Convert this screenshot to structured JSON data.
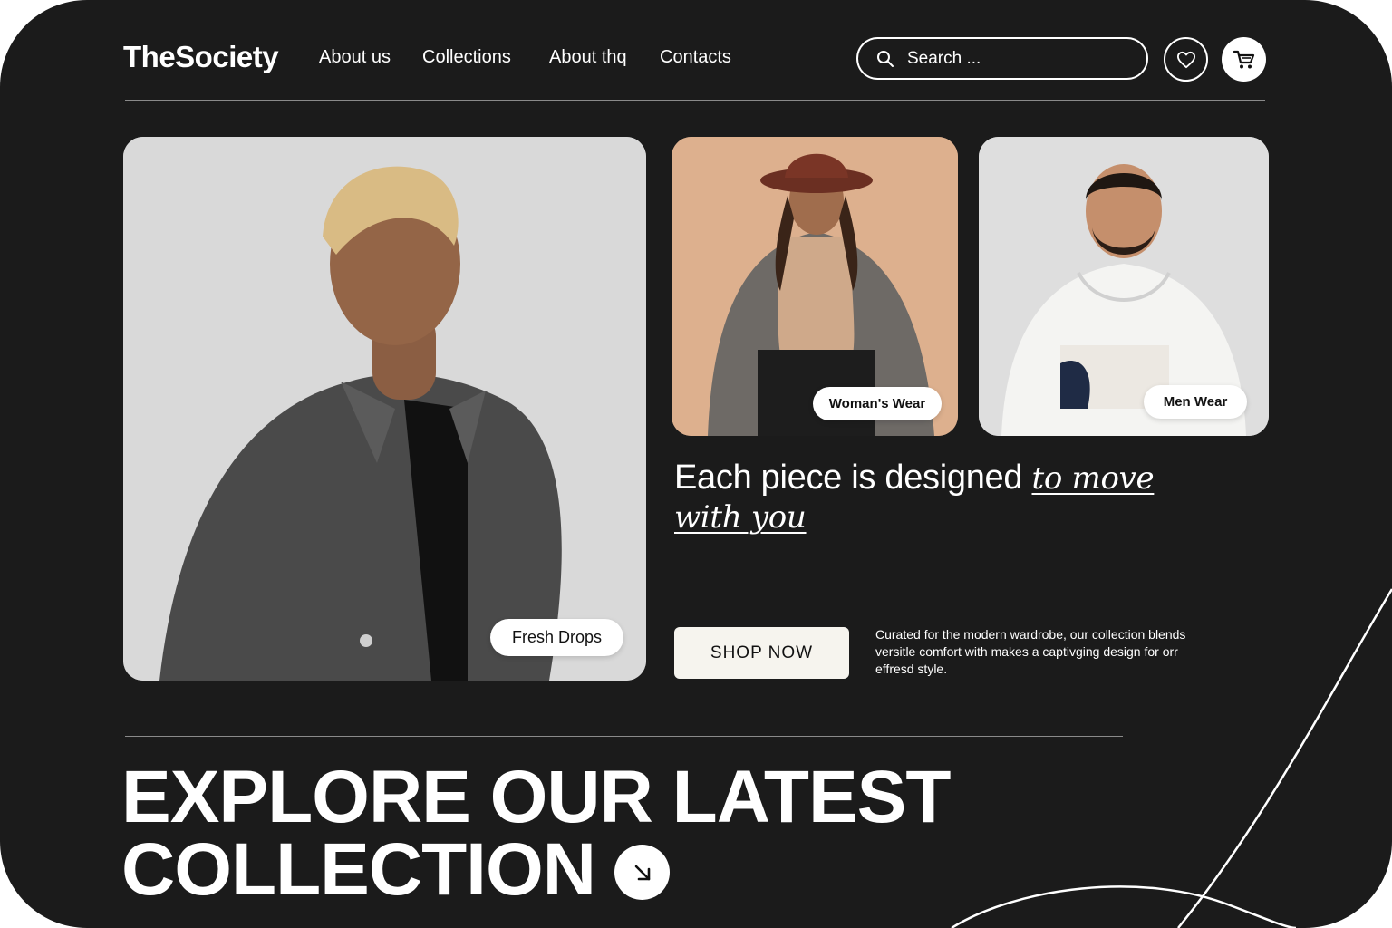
{
  "header": {
    "logo": "TheSociety",
    "nav": [
      "About us",
      "Collections",
      "About thq",
      "Contacts"
    ],
    "search_placeholder": "Search ...",
    "favorites_icon": "heart-icon",
    "cart_icon": "cart-icon"
  },
  "cards": {
    "main": {
      "label": "Fresh Drops"
    },
    "women": {
      "label": "Woman's Wear"
    },
    "men": {
      "label": "Men Wear"
    }
  },
  "hero": {
    "headline_plain": "Each piece is designed ",
    "headline_emphasis": "to move with you",
    "cta": "SHOP NOW",
    "blurb": "Curated for the modern wardrobe, our collection blends versitle comfort with makes a captivging design for orr effresd style."
  },
  "footer_banner": {
    "line1": "EXPLORE OUR LATEST",
    "line2": "COLLECTION",
    "arrow_icon": "arrow-down-right-icon"
  },
  "colors": {
    "background": "#1b1b1b",
    "text": "#ffffff",
    "button": "#f6f4ee",
    "accent_peach": "#dcae8c"
  }
}
